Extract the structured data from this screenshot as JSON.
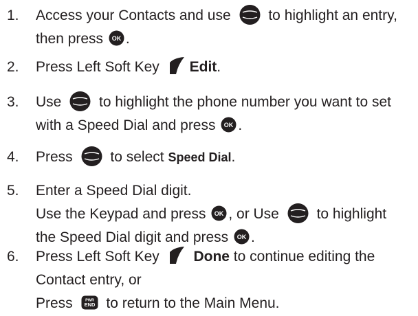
{
  "steps": [
    {
      "number": "1.",
      "lines": [
        {
          "a": "Access your Contacts and use",
          "b": "to highlight an entry,"
        },
        {
          "a": "then press",
          "b": "."
        }
      ]
    },
    {
      "number": "2.",
      "lines": [
        {
          "a": "Press Left Soft Key",
          "bold": "Edit",
          "b": "."
        }
      ]
    },
    {
      "number": "3.",
      "lines": [
        {
          "a": "Use",
          "b": "to highlight the phone number you want to set"
        },
        {
          "a": "with a Speed Dial and press",
          "b": "."
        }
      ]
    },
    {
      "number": "4.",
      "lines": [
        {
          "a": "Press",
          "b": "to select",
          "bold": "Speed Dial",
          "c": "."
        }
      ]
    },
    {
      "number": "5.",
      "lines": [
        {
          "a": "Enter a Speed Dial digit."
        },
        {
          "a": "Use the Keypad and press",
          "b": ", or Use",
          "c": "to highlight"
        },
        {
          "a": "the Speed Dial digit and press",
          "b": "."
        }
      ]
    },
    {
      "number": "6.",
      "lines": [
        {
          "a": "Press Left Soft Key",
          "bold": "Done",
          "b": "to continue editing the"
        },
        {
          "a": "Contact entry, or"
        },
        {
          "a": "Press",
          "b": "to return to the Main Menu."
        }
      ]
    }
  ],
  "icons": {
    "ok_label": "OK",
    "end_top": "PWR",
    "end_bottom": "END"
  },
  "colors": {
    "text": "#231f20",
    "icon_fill": "#231f20",
    "icon_text": "#ffffff"
  }
}
